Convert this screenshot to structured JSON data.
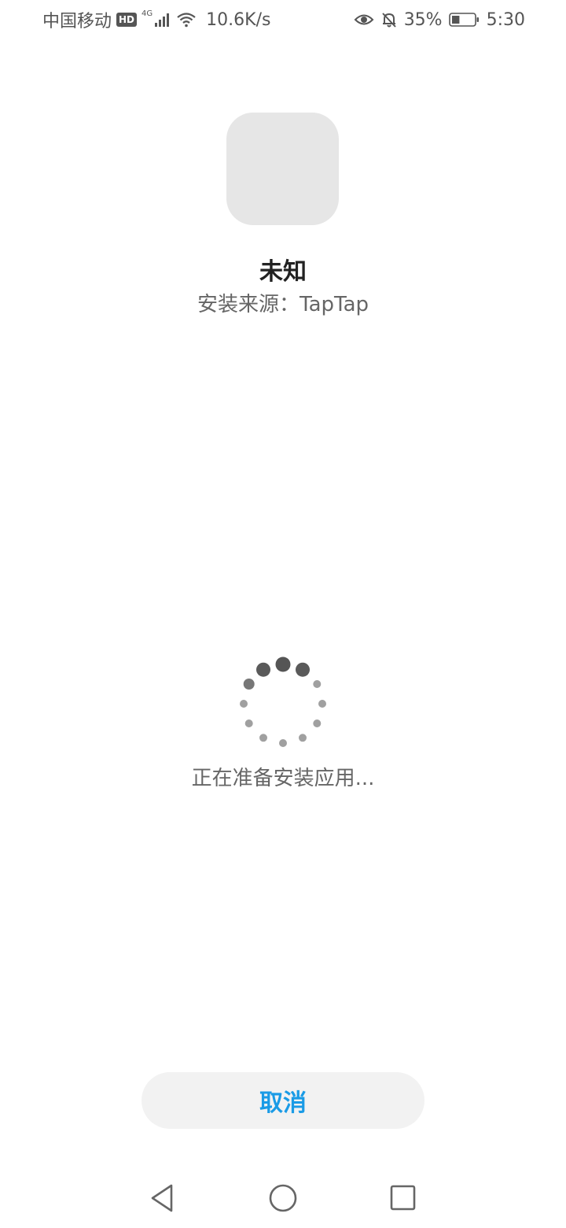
{
  "status_bar": {
    "carrier": "中国移动",
    "hd_label": "HD",
    "network_type": "4G",
    "net_speed": "10.6K/s",
    "battery_percent": "35%",
    "battery_level": 0.35,
    "time": "5:30",
    "icons": [
      "signal-icon",
      "wifi-icon",
      "eye-icon",
      "mute-bell-icon",
      "battery-icon"
    ]
  },
  "app": {
    "name": "未知",
    "install_source": "安装来源：TapTap"
  },
  "progress": {
    "message": "正在准备安装应用..."
  },
  "actions": {
    "cancel_label": "取消"
  },
  "nav": {
    "icons": [
      "back-icon",
      "home-icon",
      "recents-icon"
    ]
  },
  "colors": {
    "accent": "#1a9be6",
    "icon_placeholder": "#e6e6e6",
    "button_bg": "#f2f2f2"
  }
}
